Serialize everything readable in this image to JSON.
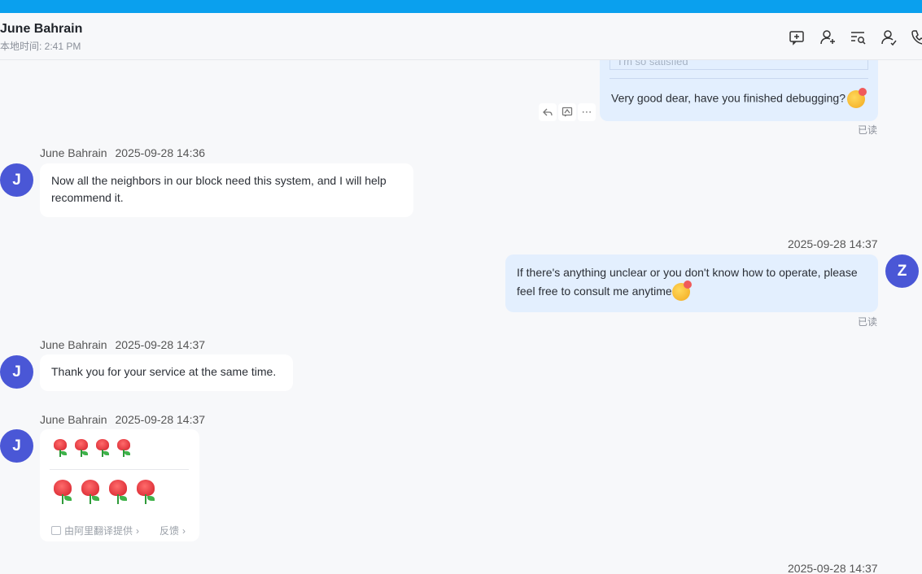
{
  "header": {
    "contact_name": "June Bahrain",
    "local_time": "本地时间: 2:41 PM",
    "icons": [
      "add-message-icon",
      "add-contact-icon",
      "search-history-icon",
      "profile-icon",
      "call-icon"
    ]
  },
  "messages": {
    "top_quote": "I'm so satisfied",
    "top_out": {
      "text": "Very good dear, have you finished debugging?",
      "status": "已读"
    },
    "m1": {
      "sender": "June Bahrain",
      "time": "2025-09-28 14:36",
      "avatar": "J",
      "text_line1": "Now all the neighbors in our block need this system, and I will help",
      "text_line2": "recommend it."
    },
    "m2": {
      "time": "2025-09-28 14:37",
      "avatar": "Z",
      "text_line1": "If there's anything unclear or you don't know how to operate, please",
      "text_line2": "feel free to consult me anytime",
      "status": "已读"
    },
    "m3": {
      "sender": "June Bahrain",
      "time": "2025-09-28 14:37",
      "avatar": "J",
      "text": "Thank you for your service at the same time."
    },
    "m4": {
      "sender": "June Bahrain",
      "time": "2025-09-28 14:37",
      "avatar": "J",
      "translation_provider": "由阿里翻译提供",
      "feedback": "反馈"
    },
    "m5": {
      "time": "2025-09-28 14:37"
    }
  },
  "colors": {
    "accent": "#0aa0ee",
    "avatar": "#4a57d6",
    "out_bubble": "#e3effe"
  }
}
